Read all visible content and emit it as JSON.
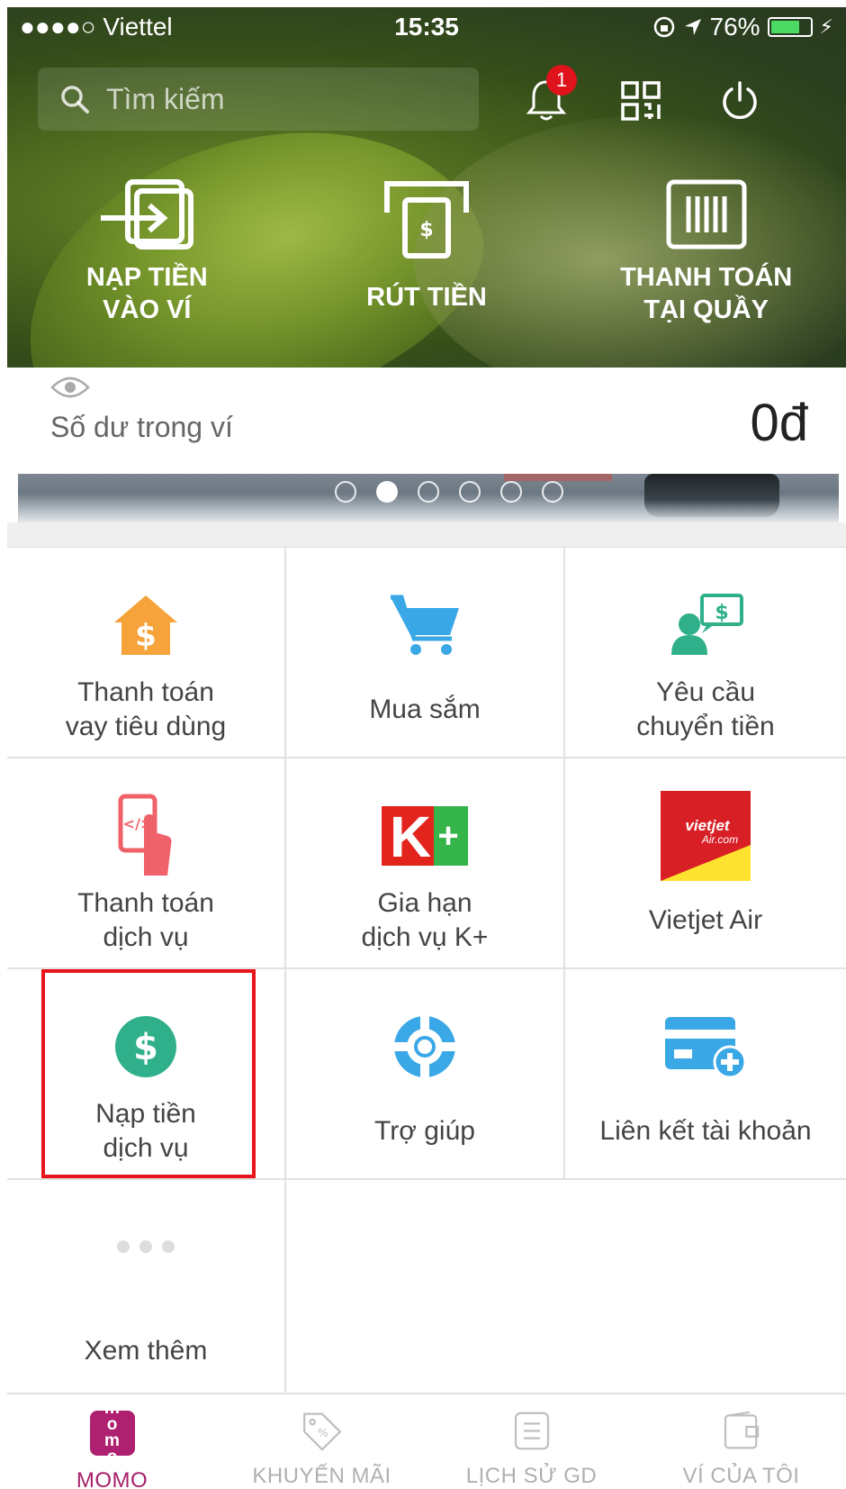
{
  "status_bar": {
    "carrier": "●●●●○ Viettel",
    "time": "15:35",
    "battery": "76%",
    "battery_level": 0.76
  },
  "header": {
    "search_placeholder": "Tìm kiếm",
    "notification_count": "1"
  },
  "quick_actions": [
    {
      "label": "NẠP TIỀN\nVÀO VÍ",
      "icon": "deposit-icon"
    },
    {
      "label": "RÚT TIỀN",
      "icon": "withdraw-icon"
    },
    {
      "label": "THANH TOÁN\nTẠI QUẦY",
      "icon": "barcode-icon"
    }
  ],
  "balance": {
    "label": "Số dư trong ví",
    "amount": "0đ"
  },
  "banner": {
    "slides": 6,
    "active_slide": 2
  },
  "services": [
    {
      "label": "Thanh toán\nvay tiêu dùng",
      "icon": "house-dollar-icon"
    },
    {
      "label": "Mua sắm",
      "icon": "shopping-cart-icon"
    },
    {
      "label": "Yêu cầu\nchuyển tiền",
      "icon": "request-money-icon"
    },
    {
      "label": "Thanh toán\ndịch vụ",
      "icon": "phone-pay-icon"
    },
    {
      "label": "Gia hạn\ndịch vụ K+",
      "icon": "kplus-logo",
      "logo_text": "K+"
    },
    {
      "label": "Vietjet Air",
      "icon": "vietjet-logo",
      "logo_text": "vietjet Air.com"
    },
    {
      "label": "Nạp tiền\ndịch vụ",
      "icon": "dollar-circle-icon"
    },
    {
      "label": "Trợ giúp",
      "icon": "lifebuoy-icon"
    },
    {
      "label": "Liên kết tài khoản",
      "icon": "link-card-icon"
    },
    {
      "label": "Xem thêm",
      "icon": "more-dots-icon"
    }
  ],
  "tabs": [
    {
      "label": "MOMO",
      "logo_text": "mo mo",
      "active": true
    },
    {
      "label": "KHUYẾN MÃI"
    },
    {
      "label": "LỊCH SỬ GD"
    },
    {
      "label": "VÍ CỦA TÔI"
    }
  ],
  "colors": {
    "accent": "#ae2070",
    "highlight": "#e8131b",
    "green_icon": "#2fb08a",
    "blue_icon": "#3aa8e6",
    "orange_icon": "#f5a33a"
  }
}
